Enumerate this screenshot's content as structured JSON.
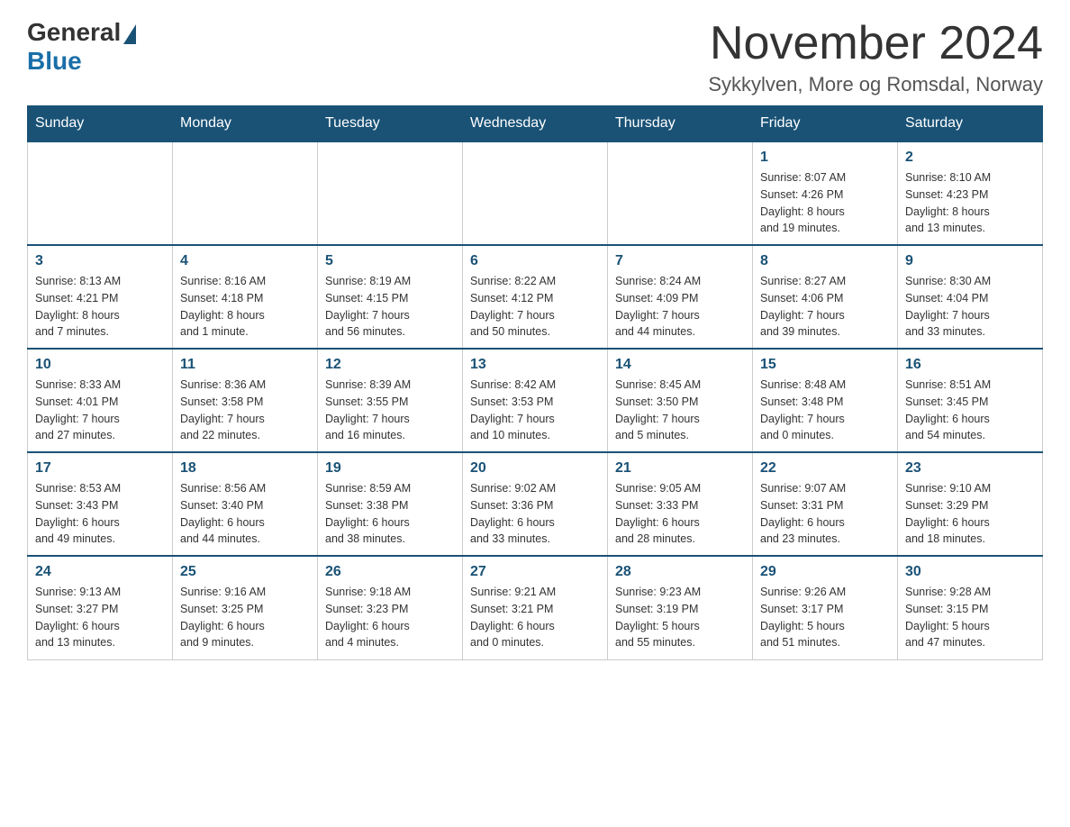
{
  "header": {
    "logo_general": "General",
    "logo_blue": "Blue",
    "month_title": "November 2024",
    "location": "Sykkylven, More og Romsdal, Norway"
  },
  "days_of_week": [
    "Sunday",
    "Monday",
    "Tuesday",
    "Wednesday",
    "Thursday",
    "Friday",
    "Saturday"
  ],
  "weeks": [
    [
      {
        "day": "",
        "info": ""
      },
      {
        "day": "",
        "info": ""
      },
      {
        "day": "",
        "info": ""
      },
      {
        "day": "",
        "info": ""
      },
      {
        "day": "",
        "info": ""
      },
      {
        "day": "1",
        "info": "Sunrise: 8:07 AM\nSunset: 4:26 PM\nDaylight: 8 hours\nand 19 minutes."
      },
      {
        "day": "2",
        "info": "Sunrise: 8:10 AM\nSunset: 4:23 PM\nDaylight: 8 hours\nand 13 minutes."
      }
    ],
    [
      {
        "day": "3",
        "info": "Sunrise: 8:13 AM\nSunset: 4:21 PM\nDaylight: 8 hours\nand 7 minutes."
      },
      {
        "day": "4",
        "info": "Sunrise: 8:16 AM\nSunset: 4:18 PM\nDaylight: 8 hours\nand 1 minute."
      },
      {
        "day": "5",
        "info": "Sunrise: 8:19 AM\nSunset: 4:15 PM\nDaylight: 7 hours\nand 56 minutes."
      },
      {
        "day": "6",
        "info": "Sunrise: 8:22 AM\nSunset: 4:12 PM\nDaylight: 7 hours\nand 50 minutes."
      },
      {
        "day": "7",
        "info": "Sunrise: 8:24 AM\nSunset: 4:09 PM\nDaylight: 7 hours\nand 44 minutes."
      },
      {
        "day": "8",
        "info": "Sunrise: 8:27 AM\nSunset: 4:06 PM\nDaylight: 7 hours\nand 39 minutes."
      },
      {
        "day": "9",
        "info": "Sunrise: 8:30 AM\nSunset: 4:04 PM\nDaylight: 7 hours\nand 33 minutes."
      }
    ],
    [
      {
        "day": "10",
        "info": "Sunrise: 8:33 AM\nSunset: 4:01 PM\nDaylight: 7 hours\nand 27 minutes."
      },
      {
        "day": "11",
        "info": "Sunrise: 8:36 AM\nSunset: 3:58 PM\nDaylight: 7 hours\nand 22 minutes."
      },
      {
        "day": "12",
        "info": "Sunrise: 8:39 AM\nSunset: 3:55 PM\nDaylight: 7 hours\nand 16 minutes."
      },
      {
        "day": "13",
        "info": "Sunrise: 8:42 AM\nSunset: 3:53 PM\nDaylight: 7 hours\nand 10 minutes."
      },
      {
        "day": "14",
        "info": "Sunrise: 8:45 AM\nSunset: 3:50 PM\nDaylight: 7 hours\nand 5 minutes."
      },
      {
        "day": "15",
        "info": "Sunrise: 8:48 AM\nSunset: 3:48 PM\nDaylight: 7 hours\nand 0 minutes."
      },
      {
        "day": "16",
        "info": "Sunrise: 8:51 AM\nSunset: 3:45 PM\nDaylight: 6 hours\nand 54 minutes."
      }
    ],
    [
      {
        "day": "17",
        "info": "Sunrise: 8:53 AM\nSunset: 3:43 PM\nDaylight: 6 hours\nand 49 minutes."
      },
      {
        "day": "18",
        "info": "Sunrise: 8:56 AM\nSunset: 3:40 PM\nDaylight: 6 hours\nand 44 minutes."
      },
      {
        "day": "19",
        "info": "Sunrise: 8:59 AM\nSunset: 3:38 PM\nDaylight: 6 hours\nand 38 minutes."
      },
      {
        "day": "20",
        "info": "Sunrise: 9:02 AM\nSunset: 3:36 PM\nDaylight: 6 hours\nand 33 minutes."
      },
      {
        "day": "21",
        "info": "Sunrise: 9:05 AM\nSunset: 3:33 PM\nDaylight: 6 hours\nand 28 minutes."
      },
      {
        "day": "22",
        "info": "Sunrise: 9:07 AM\nSunset: 3:31 PM\nDaylight: 6 hours\nand 23 minutes."
      },
      {
        "day": "23",
        "info": "Sunrise: 9:10 AM\nSunset: 3:29 PM\nDaylight: 6 hours\nand 18 minutes."
      }
    ],
    [
      {
        "day": "24",
        "info": "Sunrise: 9:13 AM\nSunset: 3:27 PM\nDaylight: 6 hours\nand 13 minutes."
      },
      {
        "day": "25",
        "info": "Sunrise: 9:16 AM\nSunset: 3:25 PM\nDaylight: 6 hours\nand 9 minutes."
      },
      {
        "day": "26",
        "info": "Sunrise: 9:18 AM\nSunset: 3:23 PM\nDaylight: 6 hours\nand 4 minutes."
      },
      {
        "day": "27",
        "info": "Sunrise: 9:21 AM\nSunset: 3:21 PM\nDaylight: 6 hours\nand 0 minutes."
      },
      {
        "day": "28",
        "info": "Sunrise: 9:23 AM\nSunset: 3:19 PM\nDaylight: 5 hours\nand 55 minutes."
      },
      {
        "day": "29",
        "info": "Sunrise: 9:26 AM\nSunset: 3:17 PM\nDaylight: 5 hours\nand 51 minutes."
      },
      {
        "day": "30",
        "info": "Sunrise: 9:28 AM\nSunset: 3:15 PM\nDaylight: 5 hours\nand 47 minutes."
      }
    ]
  ]
}
